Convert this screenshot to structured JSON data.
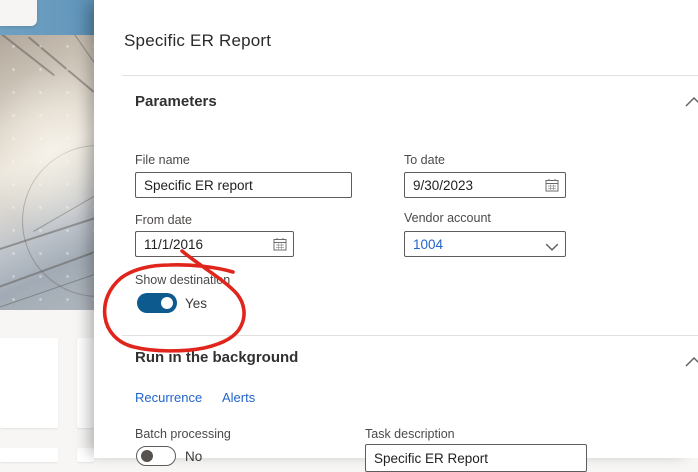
{
  "panel": {
    "title": "Specific ER Report",
    "parameters_section": {
      "heading": "Parameters",
      "fields": {
        "file_name": {
          "label": "File name",
          "value": "Specific ER report"
        },
        "to_date": {
          "label": "To date",
          "value": "9/30/2023",
          "icon": "calendar-icon"
        },
        "from_date": {
          "label": "From date",
          "value": "11/1/2016",
          "icon": "calendar-icon"
        },
        "vendor_account": {
          "label": "Vendor account",
          "value": "1004",
          "icon": "chevron-down-icon"
        },
        "show_destination": {
          "label": "Show destination",
          "value": "Yes",
          "state": "on"
        }
      }
    },
    "background_section": {
      "heading": "Run in the background",
      "links": [
        {
          "label": "Recurrence"
        },
        {
          "label": "Alerts"
        }
      ],
      "fields": {
        "batch_processing": {
          "label": "Batch processing",
          "value": "No",
          "state": "off"
        },
        "task_description": {
          "label": "Task description",
          "value": "Specific ER Report"
        }
      }
    }
  },
  "annotation": {
    "type": "hand-drawn-red-circle",
    "highlights": "show-destination-toggle",
    "color": "#e0261c"
  },
  "colors": {
    "toggle_on": "#0d5a8f",
    "link_blue": "#2266cc",
    "header_blue": "#6699bd",
    "panel_bg": "#ffffff",
    "divider": "#e3e1df"
  }
}
